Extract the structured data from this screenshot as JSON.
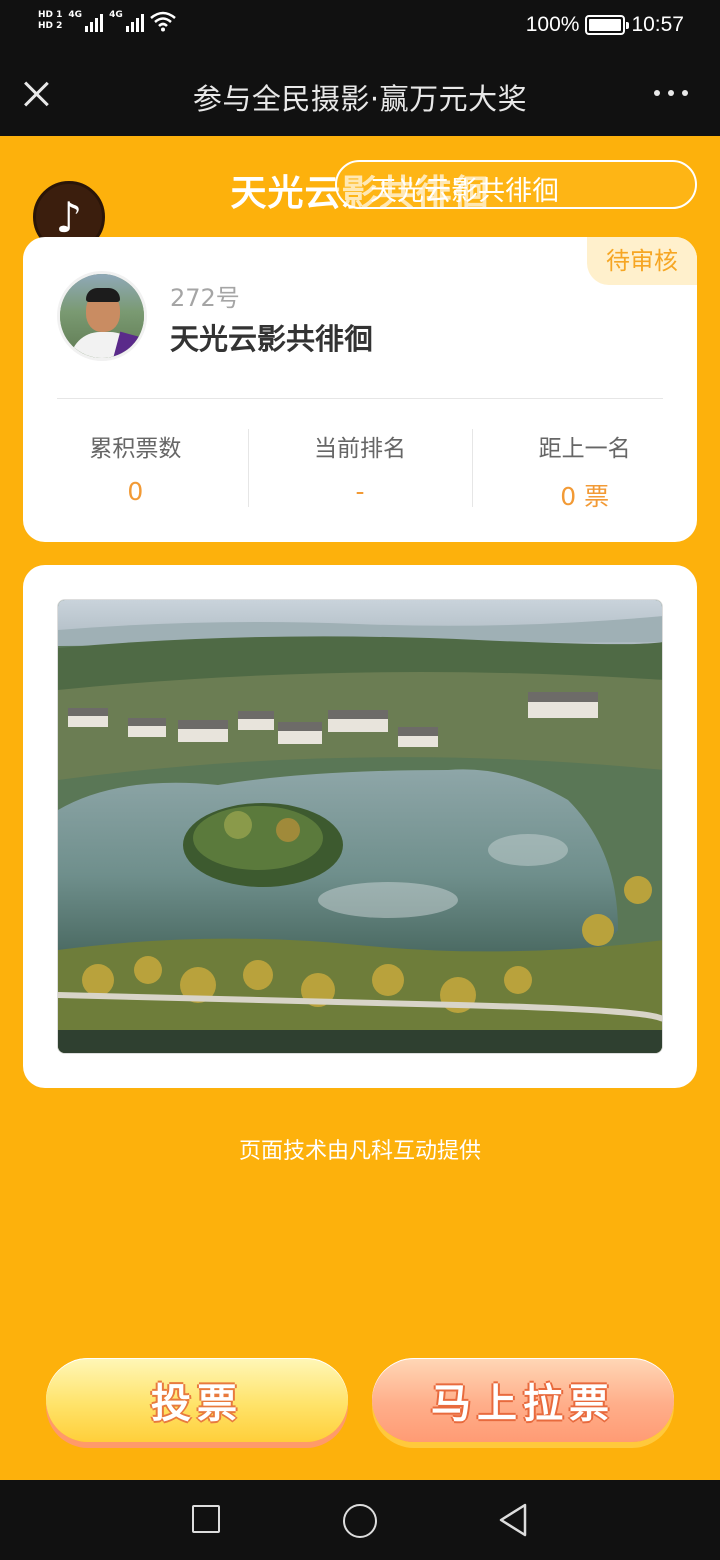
{
  "status_bar": {
    "hd1": "HD 1",
    "hd2": "HD 2",
    "net1": "4G",
    "net2": "4G",
    "battery_percent": "100%",
    "time": "10:57"
  },
  "title_bar": {
    "title": "参与全民摄影·赢万元大奖"
  },
  "header": {
    "work_title": "天光云影共徘徊",
    "marquee_text": "天光云影共徘徊"
  },
  "profile": {
    "status_badge": "待审核",
    "entry_number": "272号",
    "entry_name": "天光云影共徘徊",
    "stats": [
      {
        "label": "累积票数",
        "value": "0"
      },
      {
        "label": "当前排名",
        "value": "-"
      },
      {
        "label": "距上一名",
        "value": "0 票"
      }
    ]
  },
  "footer": {
    "credit": "页面技术由凡科互动提供"
  },
  "actions": {
    "vote_label": "投票",
    "canvass_label": "马上拉票"
  },
  "colors": {
    "page_background": "#fdb10c",
    "accent_orange": "#f29a35",
    "badge_text": "#f6a623"
  }
}
